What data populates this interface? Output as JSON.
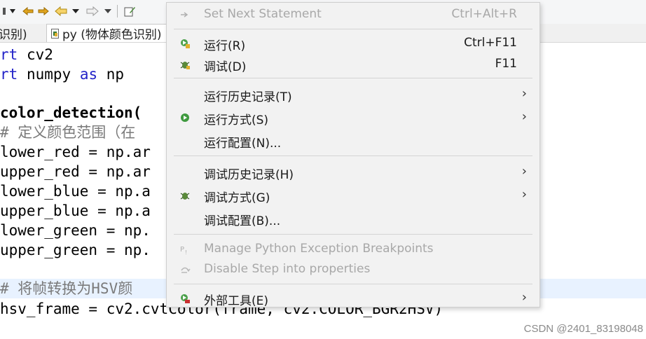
{
  "tabs": [
    {
      "label": "识别)"
    },
    {
      "label": "py (物体颜色识别)"
    }
  ],
  "code": {
    "lines": [
      {
        "prefix": "rt",
        "rest": " cv2"
      },
      {
        "prefix": "rt",
        "rest": " numpy ",
        "kw2": "as",
        "tail": " np"
      },
      {
        "text": "color_detection("
      },
      {
        "text": "# 定义颜色范围（在"
      },
      {
        "text": "lower_red = np.ar"
      },
      {
        "text": "upper_red = np.ar"
      },
      {
        "text": "lower_blue = np.a"
      },
      {
        "text": "upper_blue = np.a"
      },
      {
        "text": "lower_green = np."
      },
      {
        "text": "upper_green = np."
      },
      {
        "text": "# 将帧转换为HSV颜"
      },
      {
        "text": "hsv_frame = cv2.cvtColor(frame, cv2.COLOR_BGR2HSV)"
      }
    ]
  },
  "watermark": "CSDN @2401_83198048",
  "menu": {
    "items": [
      {
        "label": "Set Next Statement",
        "shortcut": "Ctrl+Alt+R",
        "icon": "arrow-right-icon",
        "disabled": true
      },
      {
        "label": "运行(R)",
        "shortcut": "Ctrl+F11",
        "icon": "run-icon"
      },
      {
        "label": "调试(D)",
        "shortcut": "F11",
        "icon": "debug-bug-icon"
      },
      {
        "label": "运行历史记录(T)",
        "submenu": "›"
      },
      {
        "label": "运行方式(S)",
        "submenu": "›",
        "icon": "run-green-circle-icon"
      },
      {
        "label": "运行配置(N)..."
      },
      {
        "label": "调试历史记录(H)",
        "submenu": "›"
      },
      {
        "label": "调试方式(G)",
        "submenu": "›",
        "icon": "debug-bug-icon"
      },
      {
        "label": "调试配置(B)..."
      },
      {
        "label": "Manage Python Exception Breakpoints",
        "icon": "python-breakpoint-icon",
        "disabled": true
      },
      {
        "label": "Disable Step into properties",
        "icon": "step-into-icon",
        "disabled": true
      },
      {
        "label": "外部工具(E)",
        "submenu": "›",
        "icon": "external-tools-icon"
      }
    ]
  }
}
